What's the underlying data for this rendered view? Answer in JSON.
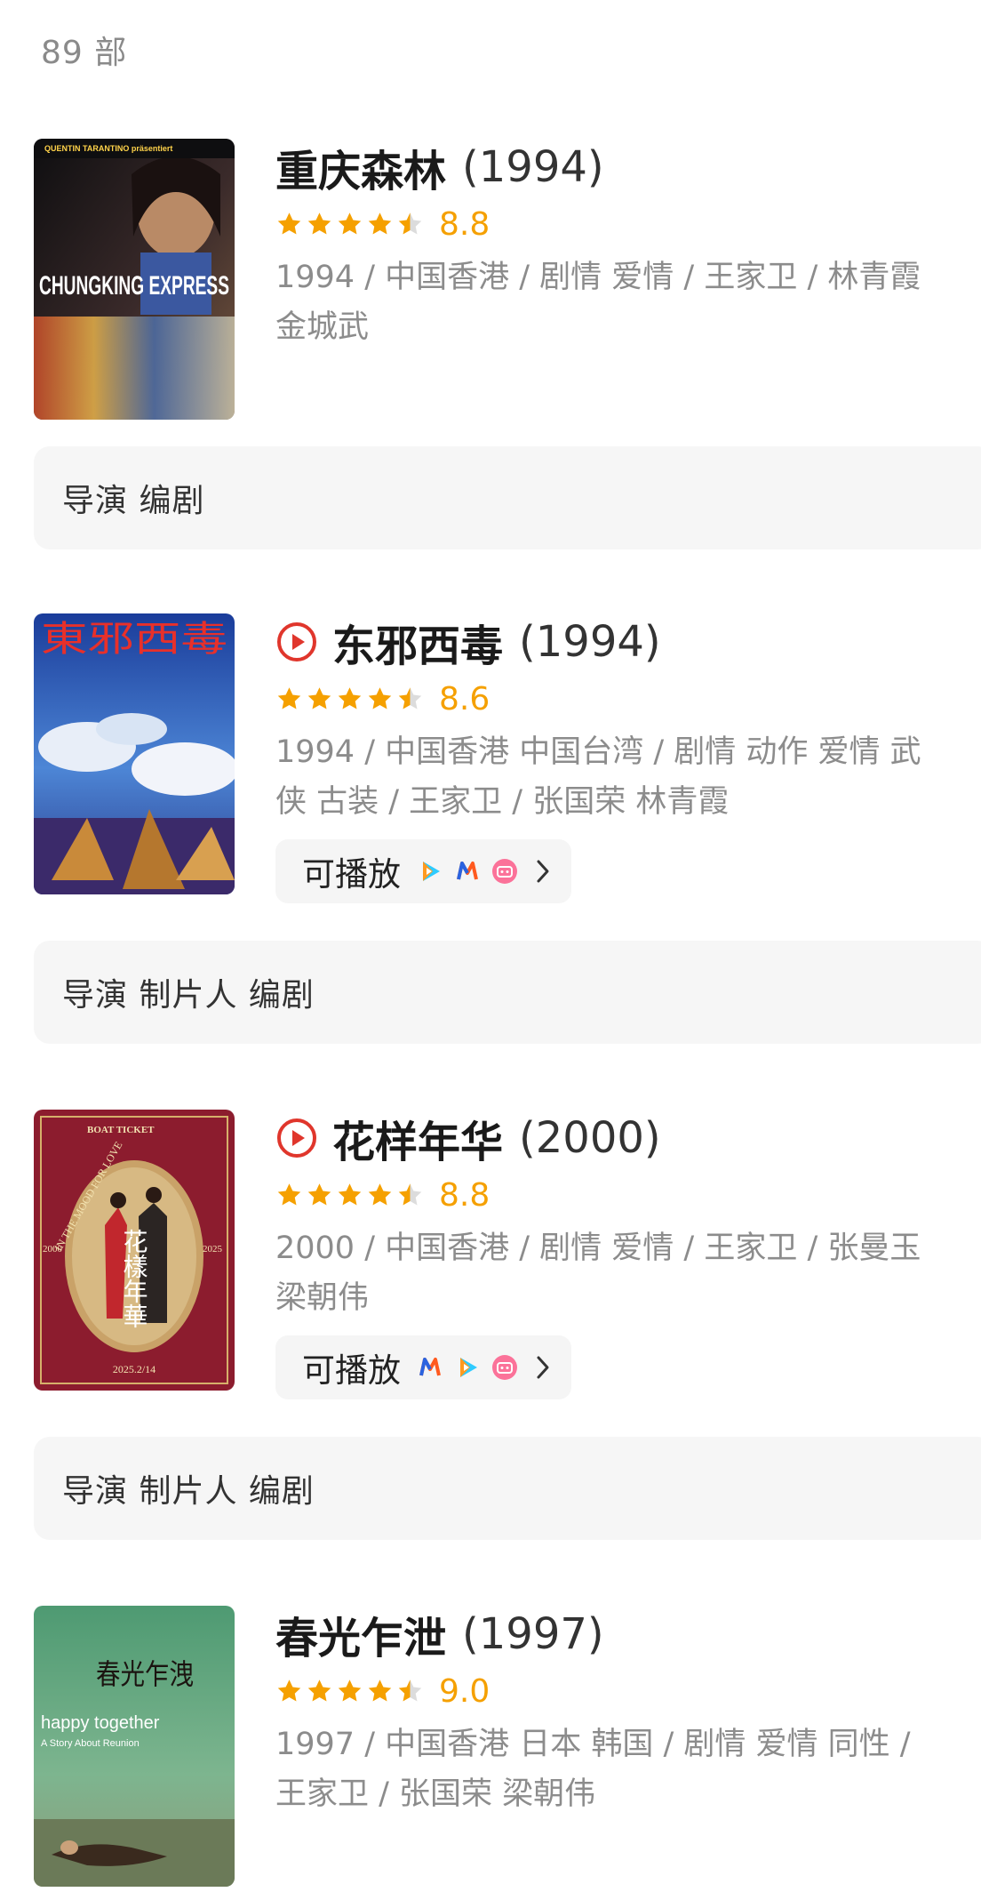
{
  "count_text": "89 部",
  "movies": [
    {
      "title": "重庆森林",
      "year": "(1994)",
      "score": "8.8",
      "meta": "1994 / 中国香港 / 剧情 爱情 / 王家卫 / 林青霞 金城武",
      "poster": {
        "top_text": "QUENTIN TARANTINO präsentiert",
        "title_text": "CHUNGKING EXPRESS"
      },
      "roles": "导演 编剧"
    },
    {
      "title": "东邪西毒",
      "year": "(1994)",
      "score": "8.6",
      "meta": "1994 / 中国香港 中国台湾 / 剧情 动作 爱情 武侠 古装 / 王家卫 / 张国荣 林青霞",
      "play_label": "可播放",
      "platforms": [
        "tencent-video-icon",
        "mango-tv-icon",
        "bilibili-icon"
      ],
      "poster": {
        "title_text": "東邪西毒"
      },
      "roles": "导演 制片人 编剧"
    },
    {
      "title": "花样年华",
      "year": "(2000)",
      "score": "8.8",
      "meta": "2000 / 中国香港 / 剧情 爱情 / 王家卫 / 张曼玉 梁朝伟",
      "play_label": "可播放",
      "platforms": [
        "mango-tv-icon",
        "tencent-video-icon",
        "bilibili-icon"
      ],
      "poster": {
        "top_text": "BOAT TICKET",
        "title_text": "花樣年華",
        "side_text": "IN THE MOOD FOR LOVE",
        "year_left": "2000",
        "year_right": "2025",
        "bottom_text": "2025.2/14"
      },
      "roles": "导演 制片人 编剧"
    },
    {
      "title": "春光乍泄",
      "year": "(1997)",
      "score": "9.0",
      "meta": "1997 / 中国香港 日本 韩国 / 剧情 爱情 同性 / 王家卫 / 张国荣 梁朝伟",
      "poster": {
        "title_text": "春光乍洩",
        "subtitle_text": "happy together",
        "tagline_text": "A Story About Reunion"
      }
    }
  ],
  "colors": {
    "accent_star": "#f5a000",
    "play_red": "#e0362c",
    "meta_gray": "#8c8c8c"
  }
}
